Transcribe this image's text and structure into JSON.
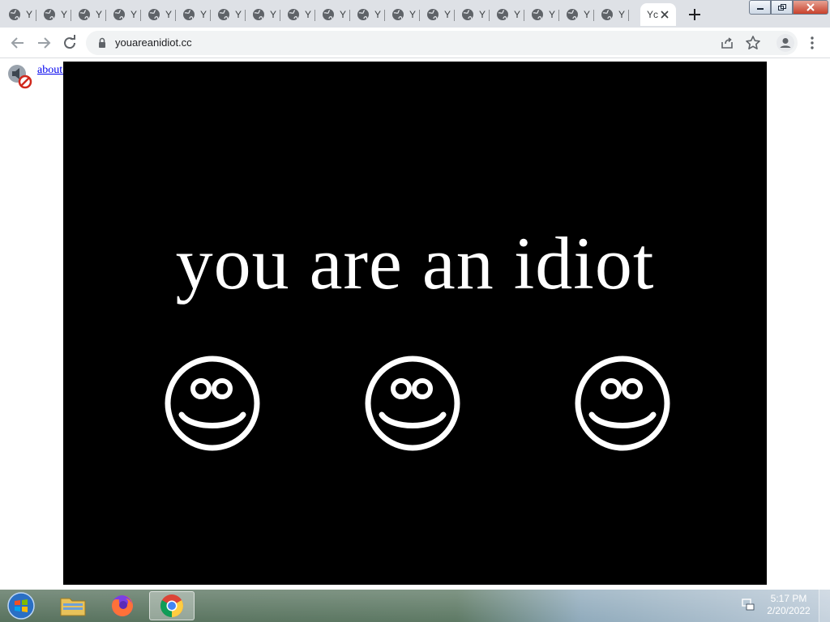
{
  "browser": {
    "tab_title": "You are an idiot",
    "inactive_tab_glyph": "Y",
    "inactive_tab_count": 18,
    "active_tab_glyph": "Yc",
    "url": "youareanidiot.cc",
    "icons": {
      "back": "arrow-left-icon",
      "forward": "arrow-right-icon",
      "reload": "reload-icon",
      "lock": "lock-icon",
      "share": "share-icon",
      "bookmark": "star-icon",
      "profile": "profile-icon",
      "menu": "kebab-menu-icon",
      "new_tab": "plus-icon",
      "close_tab": "close-icon"
    }
  },
  "page": {
    "link_text": "about:blank",
    "headline": "you are an idiot",
    "smiley_count": 3
  },
  "taskbar": {
    "apps": [
      "Windows Explorer",
      "Firefox",
      "Google Chrome"
    ],
    "active_app": "Google Chrome",
    "time": "5:17 PM",
    "date": "2/20/2022"
  },
  "colors": {
    "tabstrip": "#dee1e6",
    "stage": "#000000",
    "headline": "#ffffff",
    "link": "#0000ee"
  }
}
